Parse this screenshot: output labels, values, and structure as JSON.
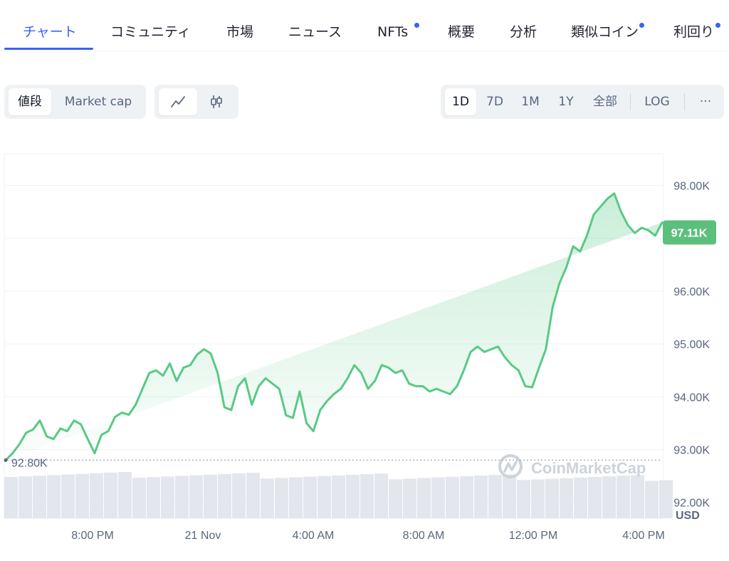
{
  "tabs": [
    {
      "label": "チャート",
      "active": true,
      "dot": false
    },
    {
      "label": "コミュニティ",
      "active": false,
      "dot": false
    },
    {
      "label": "市場",
      "active": false,
      "dot": false
    },
    {
      "label": "ニュース",
      "active": false,
      "dot": false
    },
    {
      "label": "NFTs",
      "active": false,
      "dot": true
    },
    {
      "label": "概要",
      "active": false,
      "dot": false
    },
    {
      "label": "分析",
      "active": false,
      "dot": false
    },
    {
      "label": "類似コイン",
      "active": false,
      "dot": true
    },
    {
      "label": "利回り",
      "active": false,
      "dot": true
    }
  ],
  "toolbar": {
    "metric_options": [
      "値段",
      "Market cap"
    ],
    "metric_selected": "値段",
    "chart_type_options": [
      "line-chart-icon",
      "candlestick-icon"
    ],
    "chart_type_selected": "line-chart-icon",
    "range_options": [
      "1D",
      "7D",
      "1M",
      "1Y",
      "全部"
    ],
    "range_selected": "1D",
    "log_label": "LOG",
    "more_label": "···"
  },
  "colors": {
    "accent": "#3861fb",
    "line": "#59c985",
    "price_tag": "#5dbf7d",
    "volume": "#e3e6ec",
    "grid": "#eff2f5"
  },
  "chart_data": {
    "type": "area",
    "x_ticks": [
      "8:00 PM",
      "21 Nov",
      "4:00 AM",
      "8:00 AM",
      "12:00 PM",
      "4:00 PM"
    ],
    "y_ticks": [
      "98.00K",
      "97.00K",
      "96.00K",
      "95.00K",
      "94.00K",
      "93.00K",
      "92.00K"
    ],
    "ylim": [
      91700,
      98600
    ],
    "currency": "USD",
    "open_price": 92800,
    "open_price_label": "92.80K",
    "current_price": 97110,
    "current_price_label": "97.11K",
    "watermark": "CoinMarketCap",
    "x_hours": [
      0,
      0.25,
      0.5,
      0.75,
      1.0,
      1.25,
      1.5,
      1.75,
      2.0,
      2.25,
      2.5,
      2.75,
      3.0,
      3.25,
      3.5,
      3.75,
      4.0,
      4.25,
      4.5,
      4.75,
      5.0,
      5.25,
      5.5,
      5.75,
      6.0,
      6.25,
      6.5,
      6.75,
      7.0,
      7.25,
      7.5,
      7.75,
      8.0,
      8.25,
      8.5,
      8.75,
      9.0,
      9.25,
      9.5,
      9.75,
      10.0,
      10.25,
      10.5,
      10.75,
      11.0,
      11.25,
      11.5,
      11.75,
      12.0,
      12.25,
      12.5,
      12.75,
      13.0,
      13.25,
      13.5,
      13.75,
      14.0,
      14.25,
      14.5,
      14.75,
      15.0,
      15.25,
      15.5,
      15.75,
      16.0,
      16.25,
      16.5,
      16.75,
      17.0,
      17.25,
      17.5,
      17.75,
      18.0,
      18.25,
      18.5,
      18.75,
      19.0,
      19.25,
      19.5,
      19.75,
      20.0,
      20.25,
      20.5,
      20.75,
      21.0,
      21.25,
      21.5,
      21.75,
      22.0,
      22.25,
      22.5,
      22.75,
      23.0,
      23.25,
      23.5,
      23.75,
      24.0
    ],
    "price": [
      92800,
      92930,
      93100,
      93320,
      93380,
      93550,
      93250,
      93200,
      93400,
      93350,
      93550,
      93480,
      93200,
      92930,
      93280,
      93350,
      93620,
      93700,
      93660,
      93850,
      94150,
      94450,
      94500,
      94400,
      94630,
      94300,
      94550,
      94600,
      94800,
      94900,
      94820,
      94450,
      93800,
      93750,
      94200,
      94350,
      93850,
      94200,
      94350,
      94250,
      94150,
      93650,
      93600,
      94100,
      93500,
      93350,
      93750,
      93920,
      94050,
      94150,
      94350,
      94600,
      94450,
      94150,
      94300,
      94600,
      94550,
      94450,
      94500,
      94250,
      94200,
      94200,
      94100,
      94150,
      94100,
      94050,
      94200,
      94500,
      94850,
      94950,
      94850,
      94900,
      94950,
      94750,
      94600,
      94500,
      94200,
      94180,
      94550,
      94900,
      95700,
      96150,
      96450,
      96850,
      96750,
      97050,
      97450,
      97600,
      97750,
      97850,
      97500,
      97250,
      97100,
      97200,
      97150,
      97050,
      97300,
      97110
    ]
  }
}
